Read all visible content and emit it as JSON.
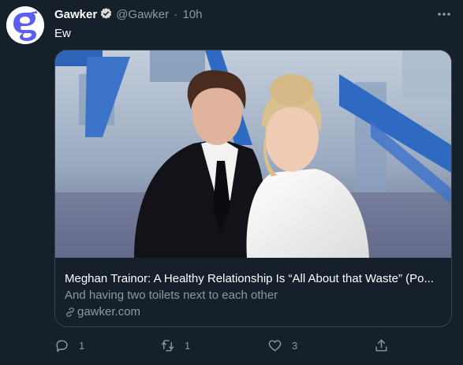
{
  "tweet": {
    "author_name": "Gawker",
    "author_handle": "@Gawker",
    "separator": "·",
    "time": "10h",
    "text": "Ew"
  },
  "card": {
    "title": "Meghan Trainor: A Healthy Relationship Is “All About that Waste” (Po...",
    "description": "And having two toilets next to each other",
    "domain": "gawker.com"
  },
  "actions": {
    "reply_count": "1",
    "retweet_count": "1",
    "like_count": "3"
  },
  "colors": {
    "background": "#15202b",
    "text": "#ffffff",
    "secondary": "#8b98a5",
    "border": "#38444d",
    "brand": "#5b5ef0"
  },
  "icons": [
    "gawker-logo-icon",
    "verified-badge-icon",
    "more-icon",
    "link-icon",
    "reply-icon",
    "retweet-icon",
    "like-icon",
    "share-icon"
  ]
}
